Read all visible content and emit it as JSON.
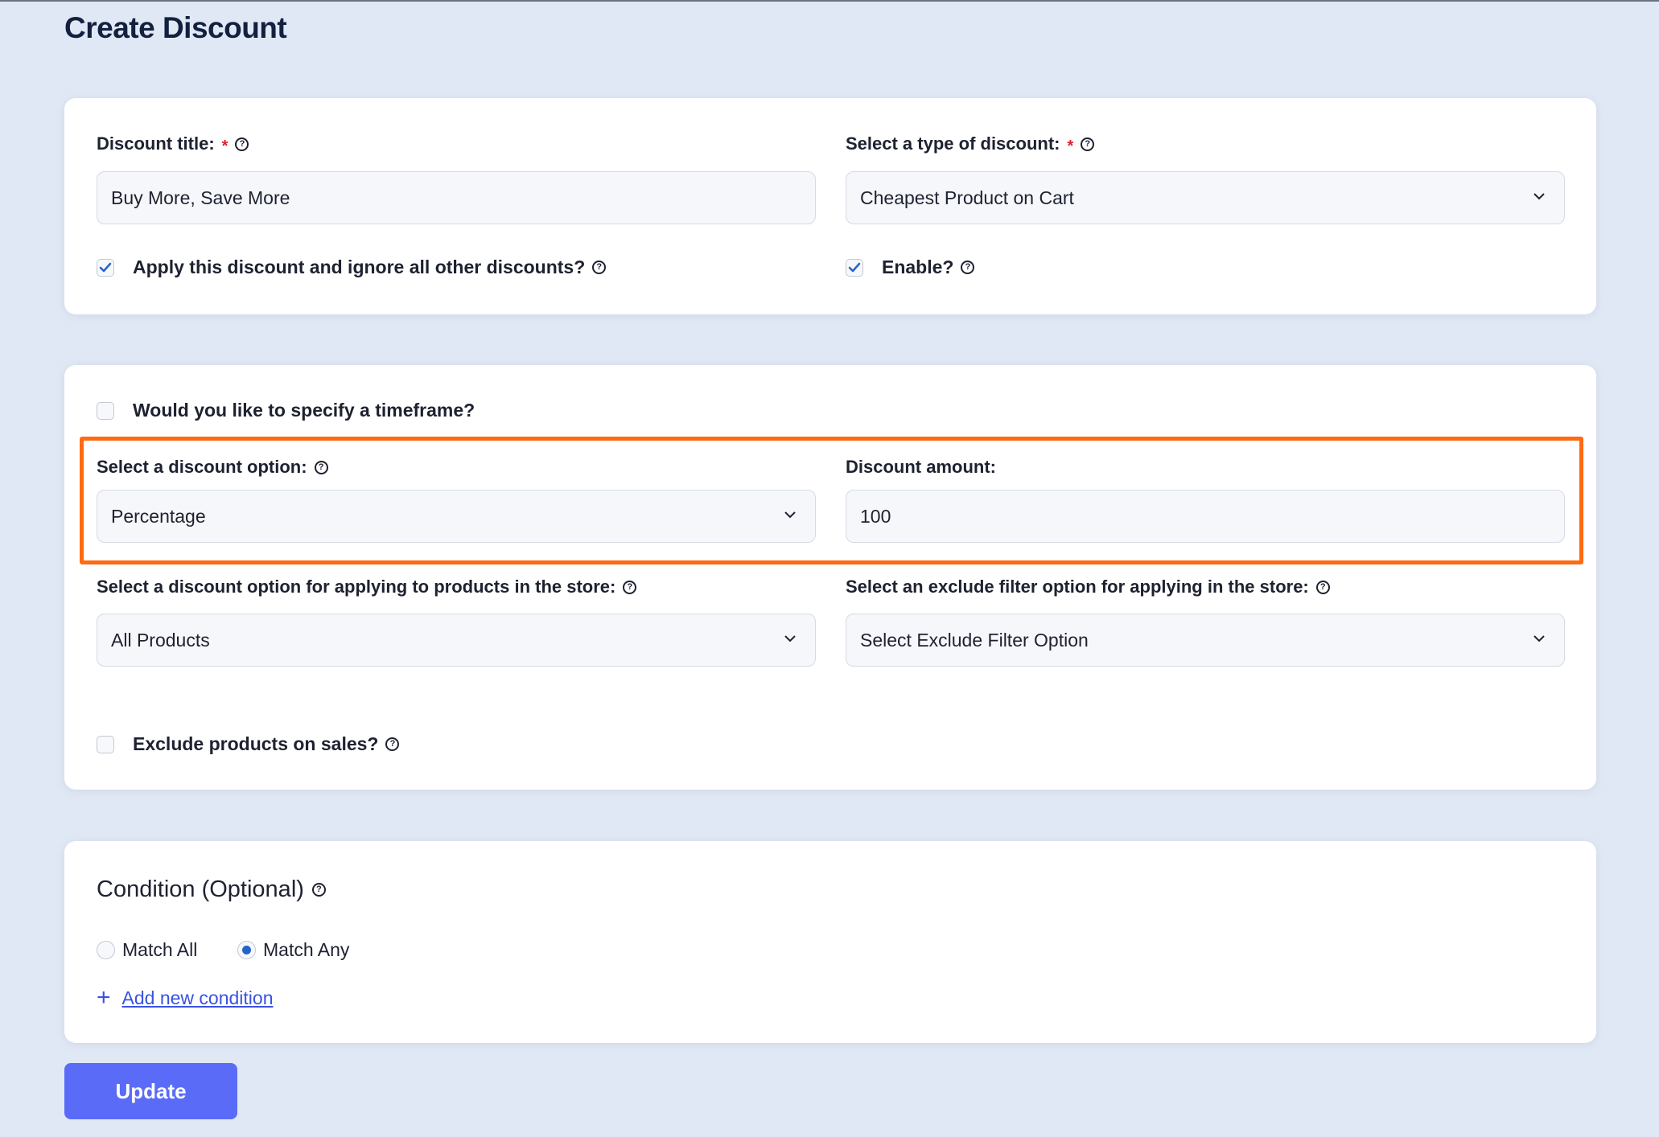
{
  "page": {
    "title": "Create Discount"
  },
  "general": {
    "title_label": "Discount title:",
    "title_value": "Buy More, Save More",
    "type_label": "Select a type of discount:",
    "type_value": "Cheapest Product on Cart",
    "required_mark": "*",
    "exclusive_label": "Apply this discount and ignore all other discounts?",
    "exclusive_checked": true,
    "enable_label": "Enable?",
    "enable_checked": true
  },
  "rules": {
    "timeframe_label": "Would you like to specify a timeframe?",
    "timeframe_checked": false,
    "option_label": "Select a discount option:",
    "option_value": "Percentage",
    "amount_label": "Discount amount:",
    "amount_value": "100",
    "apply_label": "Select a discount option for applying to products in the store:",
    "apply_value": "All Products",
    "exclude_label": "Select an exclude filter option for applying in the store:",
    "exclude_value": "Select Exclude Filter Option",
    "exclude_sales_label": "Exclude products on sales?",
    "exclude_sales_checked": false
  },
  "condition": {
    "heading": "Condition (Optional)",
    "match_all_label": "Match All",
    "match_any_label": "Match Any",
    "selected": "Match Any",
    "add_label": "Add new condition",
    "add_icon": "+"
  },
  "actions": {
    "update_label": "Update"
  },
  "colors": {
    "background": "#e1e8f5",
    "highlight": "#ff6a13",
    "primary": "#5a6cf7",
    "link": "#3a52e0",
    "required": "#e0202c",
    "check": "#2563c9"
  },
  "icons": {
    "help": "help-circle-icon",
    "chevron": "chevron-down-icon",
    "check": "check-icon"
  }
}
